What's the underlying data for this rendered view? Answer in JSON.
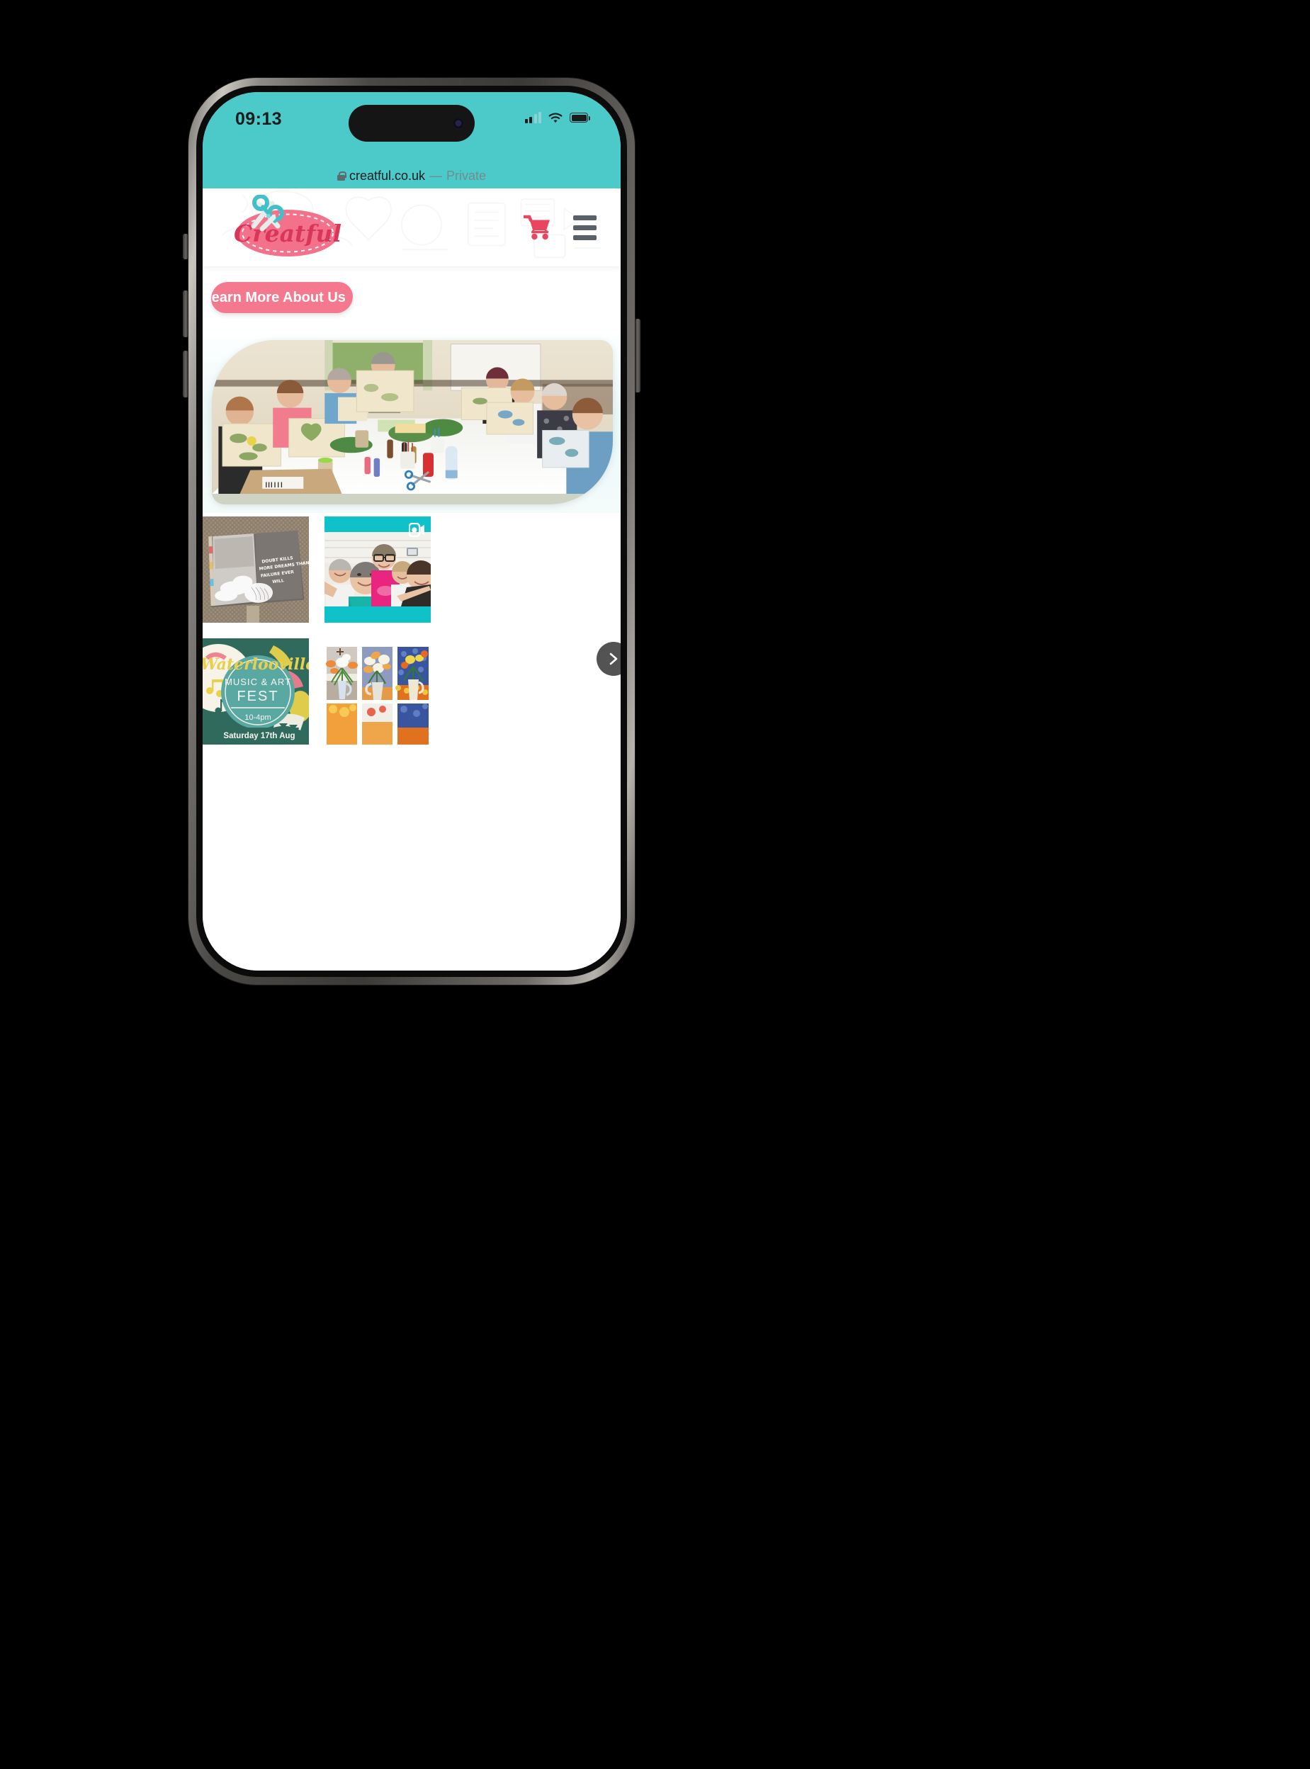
{
  "device": {
    "status_bar": {
      "clock": "09:13",
      "signal_icon": "cellular-signal-icon",
      "signal_bars_filled": 2,
      "signal_bars_total": 4,
      "wifi_icon": "wifi-icon",
      "battery_icon": "battery-icon",
      "battery_level_pct": 100
    },
    "dynamic_island": {
      "camera_icon": "front-camera-icon"
    }
  },
  "browser": {
    "lock_icon": "lock-icon",
    "domain": "creatful.co.uk",
    "separator": "—",
    "private_label": "Private"
  },
  "site": {
    "header": {
      "logo_name": "Creatful",
      "logo_icon": "creatful-logo",
      "scissors_icon": "scissors-icon",
      "cart_icon": "shopping-cart-icon",
      "menu_icon": "hamburger-menu-icon"
    },
    "cta": {
      "label": "Learn More About Us",
      "chevron": "»",
      "color": "#f4798f"
    },
    "hero": {
      "image_alt": "Craft workshop group holding eco-printed fabric panels",
      "background_color": "#eaf8f8"
    },
    "feed": {
      "next_button_icon": "chevron-right-icon",
      "items": [
        {
          "name": "sketchbook-post",
          "alt": "Open art journal sketchbook with charcoal drawing",
          "caption": "DOUBT KILLS MORE DREAMS THAN FAILURE EVER WILL",
          "media_type": "image"
        },
        {
          "name": "group-selfie-post",
          "alt": "Group selfie of five smiling women at a craft session",
          "media_type": "reel",
          "reel_icon": "instagram-reel-icon",
          "frame_color": "#0fc1c8"
        },
        {
          "name": "waterlooville-fest-post",
          "alt": "Waterlooville Music & Art Fest poster",
          "poster": {
            "title": "Waterlooville",
            "subtitle": "MUSIC & ART",
            "fest": "FEST",
            "time": "10-4pm",
            "date": "Saturday 17th Aug"
          },
          "media_type": "image"
        },
        {
          "name": "flower-paintings-post",
          "alt": "Three images of lilies in a white jug: photo and two paintings",
          "media_type": "image"
        }
      ]
    }
  },
  "colors": {
    "status_bar_teal": "#4cc9c9",
    "brand_pink": "#f4798f",
    "cart_red": "#e8455f",
    "instagram_teal": "#0fc1c8",
    "menu_gray": "#5a6068"
  }
}
